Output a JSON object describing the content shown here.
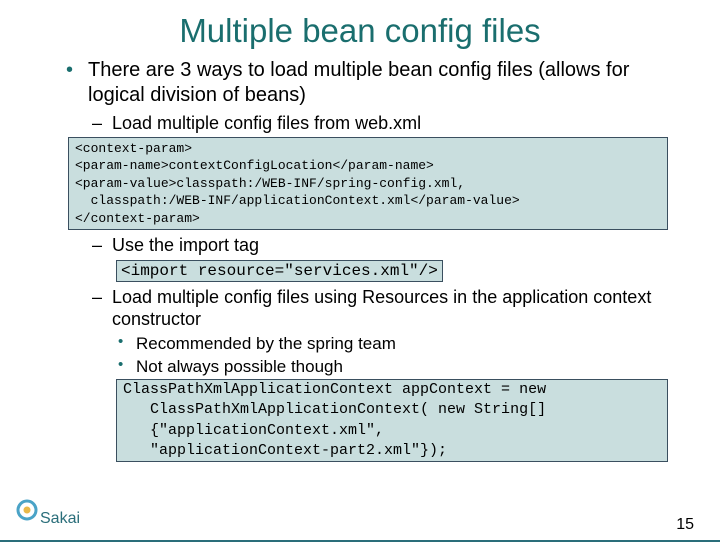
{
  "title": "Multiple bean config files",
  "bullet1": "There are 3 ways to load multiple bean config files (allows for logical division of beans)",
  "sub1": "Load multiple config files from web.xml",
  "code1": "<context-param>\n<param-name>contextConfigLocation</param-name>\n<param-value>classpath:/WEB-INF/spring-config.xml,\n  classpath:/WEB-INF/applicationContext.xml</param-value>\n</context-param>",
  "sub2": "Use the import tag",
  "code2": "<import resource=\"services.xml\"/>",
  "sub3": "Load multiple config files using Resources in the application context constructor",
  "rec1": "Recommended by the spring team",
  "rec2": "Not always possible though",
  "code3": "ClassPathXmlApplicationContext appContext = new \n   ClassPathXmlApplicationContext( new String[] \n   {\"applicationContext.xml\", \n   \"applicationContext-part2.xml\"});",
  "pagenum": "15",
  "logo_text": "Sakai"
}
